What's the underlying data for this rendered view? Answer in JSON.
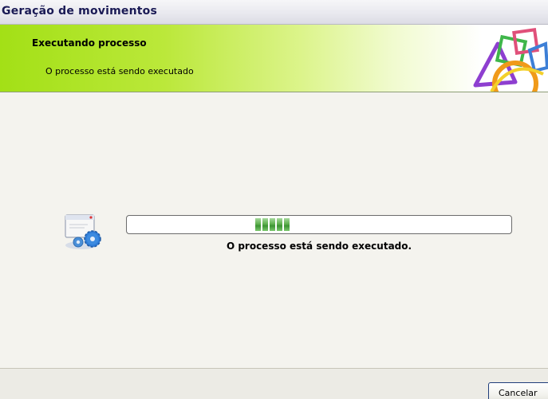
{
  "window": {
    "title": "Geração de movimentos"
  },
  "header": {
    "title": "Executando processo",
    "subtitle": "O processo está sendo executado",
    "logo_icon": "shapes-logo-icon"
  },
  "main": {
    "process_icon": "computer-gears-icon",
    "progress": {
      "state": "marquee",
      "segments_visible": 5,
      "color": "#4caf3e"
    },
    "status_text": "O processo está sendo executado."
  },
  "footer": {
    "cancel_label": "Cancelar"
  }
}
